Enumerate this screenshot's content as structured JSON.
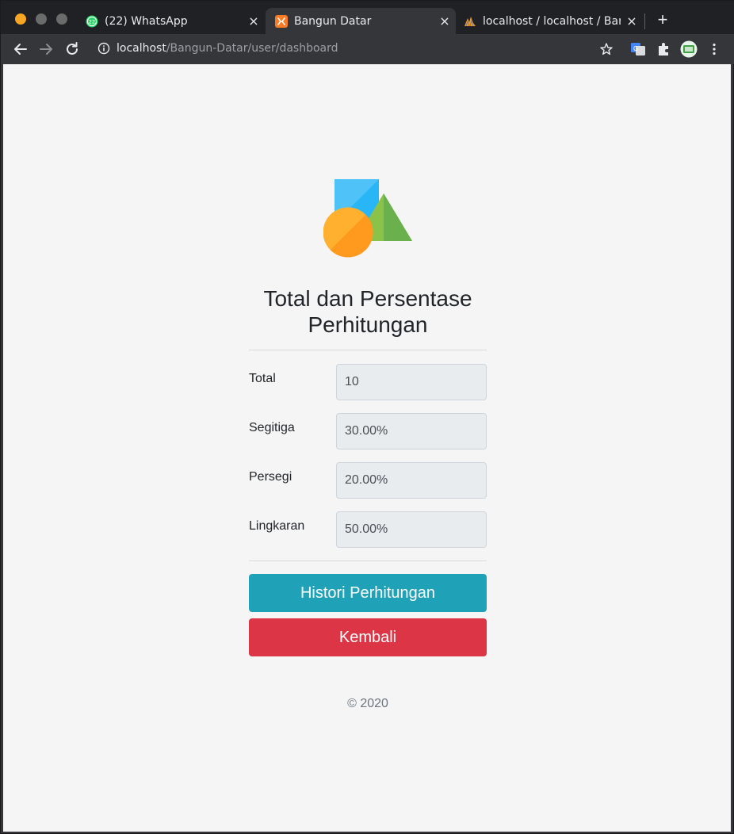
{
  "browser": {
    "tabs": [
      {
        "title": "(22) WhatsApp",
        "badge": "22"
      },
      {
        "title": "Bangun Datar"
      },
      {
        "title": "localhost / localhost / Bangun"
      }
    ],
    "close_glyph": "×",
    "new_tab_glyph": "+",
    "url_host": "localhost",
    "url_path": "/Bangun-Datar/user/dashboard",
    "colors": {
      "whatsapp": "#25d366",
      "xampp": "#fb7a24",
      "active_tab": "#35363a"
    }
  },
  "page": {
    "heading": "Total dan Persentase Perhitungan",
    "rows": [
      {
        "label": "Total",
        "value": "10"
      },
      {
        "label": "Segitiga",
        "value": "30.00%"
      },
      {
        "label": "Persegi",
        "value": "20.00%"
      },
      {
        "label": "Lingkaran",
        "value": "50.00%"
      }
    ],
    "history_button": "Histori Perhitungan",
    "back_button": "Kembali",
    "footer": "© 2020",
    "colors": {
      "info": "#1fa2b8",
      "danger": "#dc3545",
      "square": "#4fc3f7",
      "triangle": "#7cc243",
      "circle": "#ffa726"
    }
  }
}
